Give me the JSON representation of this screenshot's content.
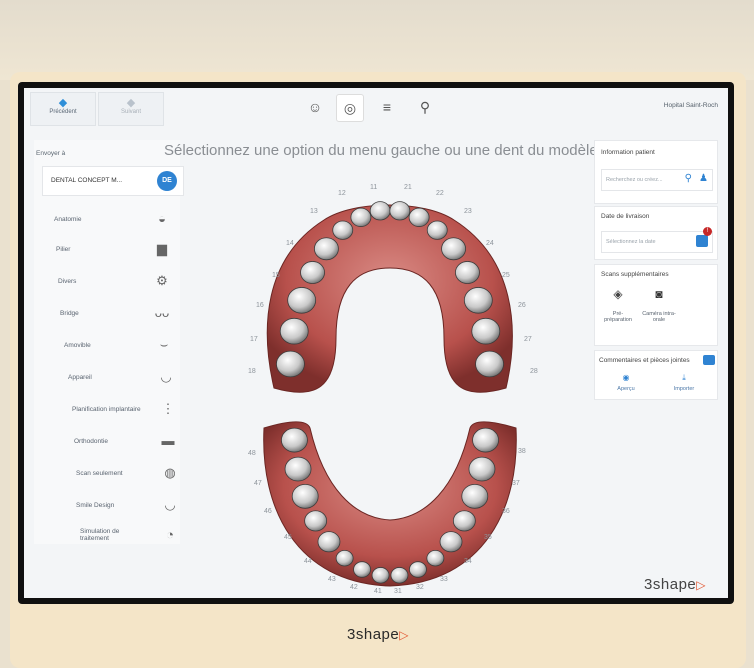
{
  "nav": {
    "previous": "Précédent",
    "next": "Suivant"
  },
  "header": {
    "hospital": "Hopital Saint-Roch",
    "mode_icons": [
      "patient-icon",
      "dental-scan-icon",
      "tools-icon",
      "user-settings-icon"
    ]
  },
  "left_panel": {
    "send_to_label": "Envoyer à",
    "lab_name": "DENTAL CONCEPT M...",
    "lab_badge": "DE",
    "items": [
      {
        "label": "Anatomie",
        "icon": "crown-icon"
      },
      {
        "label": "Pilier",
        "icon": "abutment-icon"
      },
      {
        "label": "Divers",
        "icon": "misc-icon"
      },
      {
        "label": "Bridge",
        "icon": "bridge-icon"
      },
      {
        "label": "Amovible",
        "icon": "removable-icon"
      },
      {
        "label": "Appareil",
        "icon": "appliance-icon"
      },
      {
        "label": "Planification implantaire",
        "icon": "implant-icon"
      },
      {
        "label": "Orthodontie",
        "icon": "orthodontics-icon"
      },
      {
        "label": "Scan seulement",
        "icon": "scan-only-icon"
      },
      {
        "label": "Smile Design",
        "icon": "smile-icon"
      },
      {
        "label": "Simulation de traitement",
        "icon": "treatment-sim-icon"
      }
    ]
  },
  "main": {
    "title": "Sélectionnez une option du menu gauche ou une dent du modèle",
    "upper_teeth": [
      "11",
      "12",
      "13",
      "14",
      "15",
      "16",
      "17",
      "18",
      "21",
      "22",
      "23",
      "24",
      "25",
      "26",
      "27",
      "28"
    ],
    "lower_teeth": [
      "31",
      "32",
      "33",
      "34",
      "35",
      "36",
      "37",
      "38",
      "41",
      "42",
      "43",
      "44",
      "45",
      "46",
      "47",
      "48"
    ]
  },
  "right_panel": {
    "patient_info_title": "Information patient",
    "search_placeholder": "Recherchez ou créez...",
    "delivery_title": "Date de livraison",
    "delivery_placeholder": "Sélectionnez la date",
    "delivery_alert": "!",
    "extra_scans_title": "Scans supplémentaires",
    "pre_prep": "Pré-préparation",
    "intraoral_cam": "Caméra intra-orale",
    "comments_title": "Commentaires et pièces jointes",
    "preview": "Aperçu",
    "import": "Importer"
  },
  "brand": {
    "name": "3shape",
    "logo_mark": "▷"
  },
  "colors": {
    "accent_blue": "#2f83d2",
    "brand_orange": "#e2542f",
    "gum": "#b8514c"
  }
}
